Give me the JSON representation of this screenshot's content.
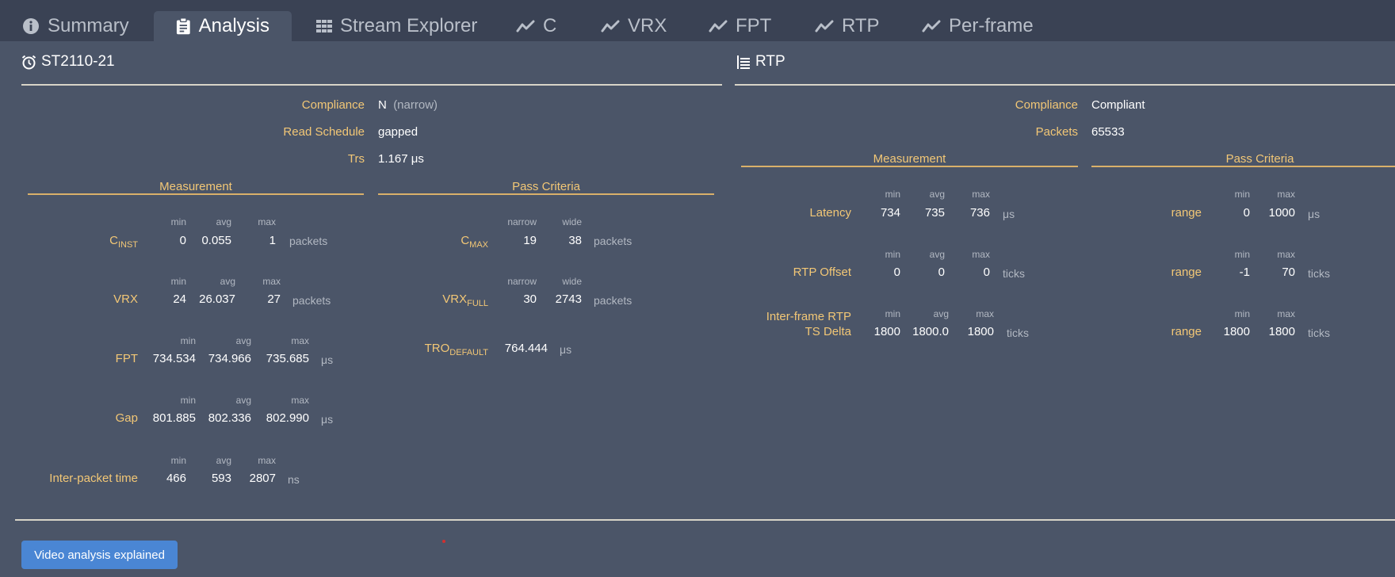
{
  "tabs": [
    {
      "label": "Summary"
    },
    {
      "label": "Analysis"
    },
    {
      "label": "Stream Explorer"
    },
    {
      "label": "C"
    },
    {
      "label": "VRX"
    },
    {
      "label": "FPT"
    },
    {
      "label": "RTP"
    },
    {
      "label": "Per-frame"
    }
  ],
  "st2110": {
    "title": "ST2110-21",
    "compliance_label": "Compliance",
    "compliance_value": "N",
    "compliance_note": "(narrow)",
    "read_schedule_label": "Read Schedule",
    "read_schedule_value": "gapped",
    "trs_label": "Trs",
    "trs_value": "1.167 μs",
    "measurement_header": "Measurement",
    "pass_criteria_header": "Pass Criteria",
    "col_min": "min",
    "col_avg": "avg",
    "col_max": "max",
    "col_narrow": "narrow",
    "col_wide": "wide",
    "cinst": {
      "label": "C",
      "sub": "INST",
      "min": "0",
      "avg": "0.055",
      "max": "1",
      "unit": "packets"
    },
    "vrx": {
      "label": "VRX",
      "min": "24",
      "avg": "26.037",
      "max": "27",
      "unit": "packets"
    },
    "fpt": {
      "label": "FPT",
      "min": "734.534",
      "avg": "734.966",
      "max": "735.685",
      "unit": "μs"
    },
    "gap": {
      "label": "Gap",
      "min": "801.885",
      "avg": "802.336",
      "max": "802.990",
      "unit": "μs"
    },
    "ipt": {
      "label": "Inter-packet time",
      "min": "466",
      "avg": "593",
      "max": "2807",
      "unit": "ns"
    },
    "cmax": {
      "label": "C",
      "sub": "MAX",
      "narrow": "19",
      "wide": "38",
      "unit": "packets"
    },
    "vrxfull": {
      "label": "VRX",
      "sub": "FULL",
      "narrow": "30",
      "wide": "2743",
      "unit": "packets"
    },
    "tro": {
      "label": "TRO",
      "sub": "DEFAULT",
      "value": "764.444",
      "unit": "μs"
    }
  },
  "rtp": {
    "title": "RTP",
    "compliance_label": "Compliance",
    "compliance_value": "Compliant",
    "packets_label": "Packets",
    "packets_value": "65533",
    "measurement_header": "Measurement",
    "pass_criteria_header": "Pass Criteria",
    "col_min": "min",
    "col_avg": "avg",
    "col_max": "max",
    "latency": {
      "label": "Latency",
      "min": "734",
      "avg": "735",
      "max": "736",
      "unit": "μs"
    },
    "offset": {
      "label": "RTP Offset",
      "min": "0",
      "avg": "0",
      "max": "0",
      "unit": "ticks"
    },
    "tsdelta": {
      "label1": "Inter-frame RTP",
      "label2": "TS Delta",
      "min": "1800",
      "avg": "1800.0",
      "max": "1800",
      "unit": "ticks"
    },
    "pc_label": "range",
    "pc_latency": {
      "min": "0",
      "max": "1000",
      "unit": "μs"
    },
    "pc_offset": {
      "min": "-1",
      "max": "70",
      "unit": "ticks"
    },
    "pc_tsdelta": {
      "min": "1800",
      "max": "1800",
      "unit": "ticks"
    }
  },
  "footer": {
    "button_label": "Video analysis explained"
  }
}
